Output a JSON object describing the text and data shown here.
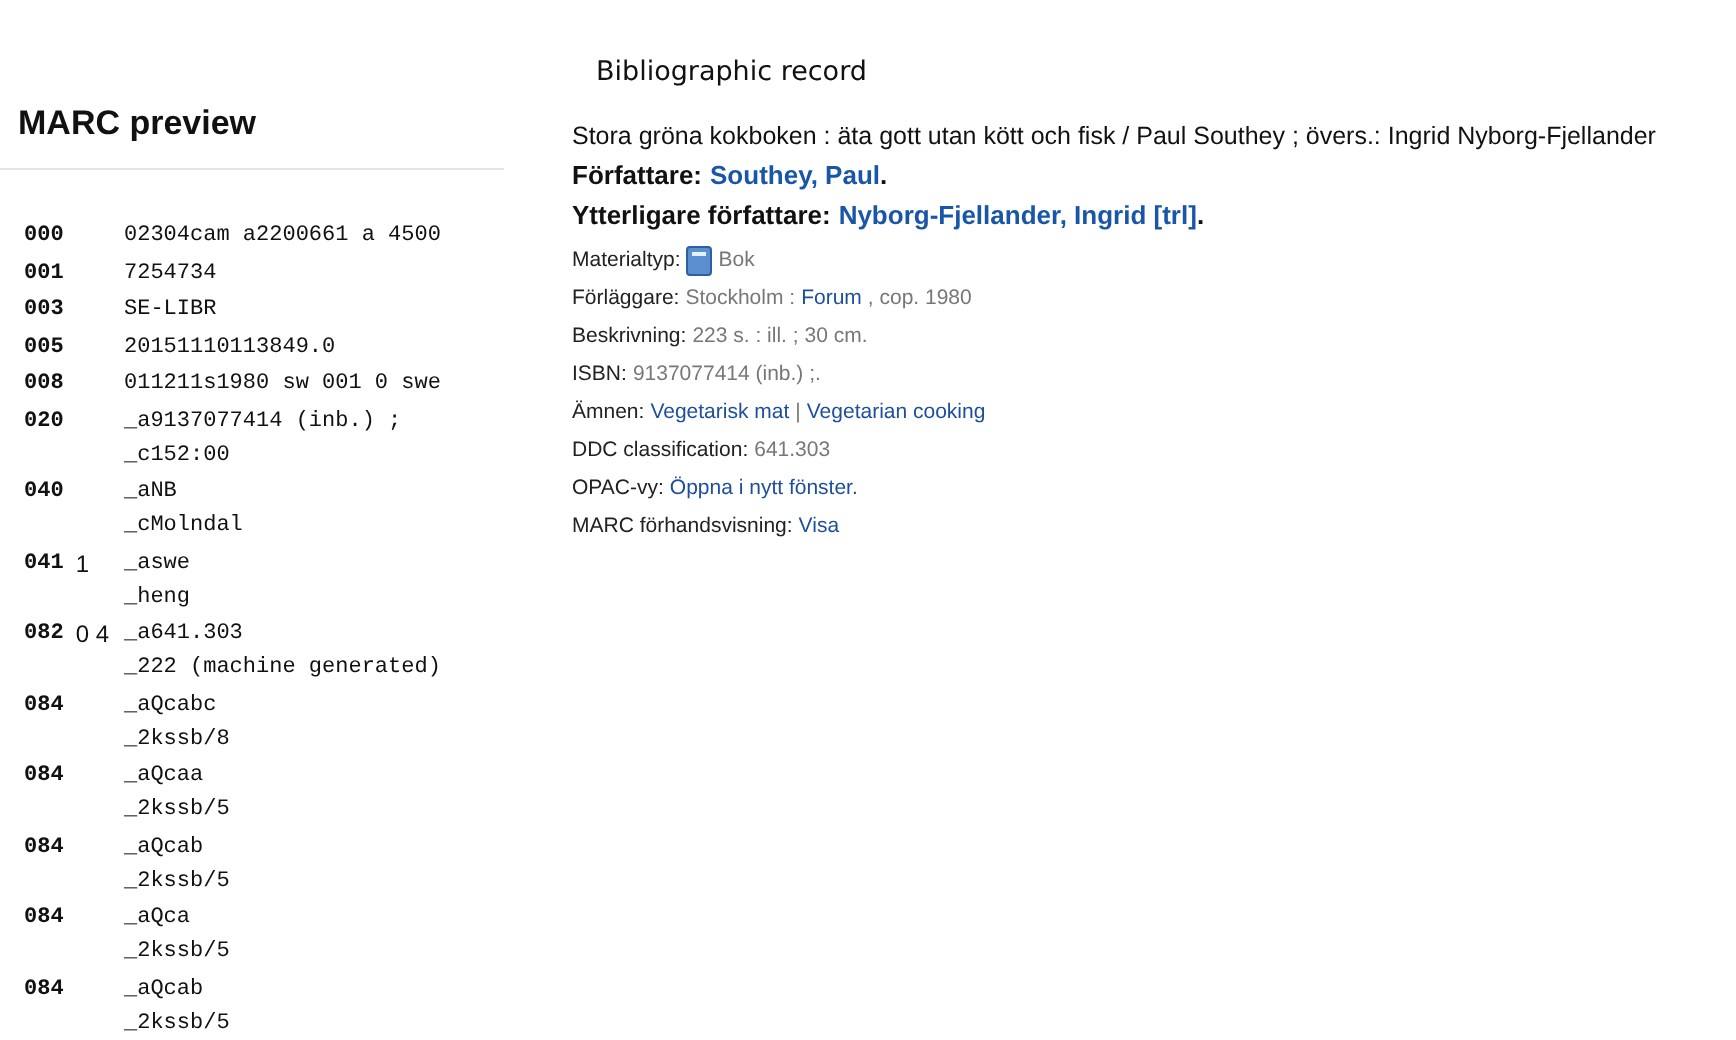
{
  "marc_preview": {
    "title": "MARC preview",
    "fields": [
      {
        "tag": "000",
        "subfields": [
          "02304cam a2200661 a 4500"
        ]
      },
      {
        "tag": "001",
        "subfields": [
          "7254734"
        ]
      },
      {
        "tag": "003",
        "subfields": [
          "SE-LIBR"
        ]
      },
      {
        "tag": "005",
        "subfields": [
          "20151110113849.0"
        ]
      },
      {
        "tag": "008",
        "subfields": [
          "011211s1980 sw 001 0 swe"
        ]
      },
      {
        "tag": "020",
        "subfields": [
          "_a9137077414 (inb.) ;",
          "_c152:00"
        ]
      },
      {
        "tag": "040",
        "subfields": [
          "_aNB",
          "_cMolndal"
        ]
      },
      {
        "tag": "041",
        "indicators": "1",
        "subfields": [
          "_aswe",
          "_heng"
        ]
      },
      {
        "tag": "082",
        "indicators": "0 4",
        "subfields": [
          "_a641.303",
          "_222 (machine generated)"
        ]
      },
      {
        "tag": "084",
        "subfields": [
          "_aQcabc",
          "_2kssb/8"
        ]
      },
      {
        "tag": "084",
        "subfields": [
          "_aQcaa",
          "_2kssb/5"
        ]
      },
      {
        "tag": "084",
        "subfields": [
          "_aQcab",
          "_2kssb/5"
        ]
      },
      {
        "tag": "084",
        "subfields": [
          "_aQca",
          "_2kssb/5"
        ]
      },
      {
        "tag": "084",
        "subfields": [
          "_aQcab",
          "_2kssb/5"
        ]
      }
    ]
  },
  "record": {
    "heading": "Bibliographic record",
    "title_statement": "Stora gröna kokboken : äta gott utan kött och fisk / Paul Southey ; övers.: Ingrid Nyborg-Fjellander",
    "authors": [
      {
        "label": "Författare:",
        "name": "Southey, Paul",
        "end": "."
      },
      {
        "label": "Ytterligare författare:",
        "name": "Nyborg-Fjellander, Ingrid [trl]",
        "end": "."
      }
    ],
    "details": [
      {
        "label": "Materialtyp:",
        "kind": "material",
        "parts": [
          {
            "kind": "plain",
            "text": "Bok"
          }
        ]
      },
      {
        "label": "Förläggare:",
        "kind": "text",
        "parts": [
          {
            "kind": "plain",
            "text": "Stockholm :"
          },
          {
            "kind": "link",
            "text": "Forum"
          },
          {
            "kind": "plain",
            "text": ", cop. 1980"
          }
        ]
      },
      {
        "label": "Beskrivning:",
        "kind": "text",
        "parts": [
          {
            "kind": "plain",
            "text": "223 s. : ill. ; 30 cm."
          }
        ]
      },
      {
        "label": "ISBN:",
        "kind": "text",
        "parts": [
          {
            "kind": "plain",
            "text": "9137077414 (inb.) ;."
          }
        ]
      },
      {
        "label": "Ämnen:",
        "kind": "text",
        "parts": [
          {
            "kind": "link",
            "text": "Vegetarisk mat"
          },
          {
            "kind": "plain",
            "text": "|"
          },
          {
            "kind": "link",
            "text": "Vegetarian cooking"
          }
        ]
      },
      {
        "label": "DDC classification:",
        "kind": "text",
        "parts": [
          {
            "kind": "plain",
            "text": "641.303"
          }
        ]
      },
      {
        "label": "OPAC-vy:",
        "kind": "text",
        "parts": [
          {
            "kind": "link",
            "text": "Öppna i nytt fönster."
          }
        ]
      },
      {
        "label": "MARC förhandsvisning:",
        "kind": "text",
        "parts": [
          {
            "kind": "link",
            "text": "Visa"
          }
        ]
      }
    ]
  }
}
